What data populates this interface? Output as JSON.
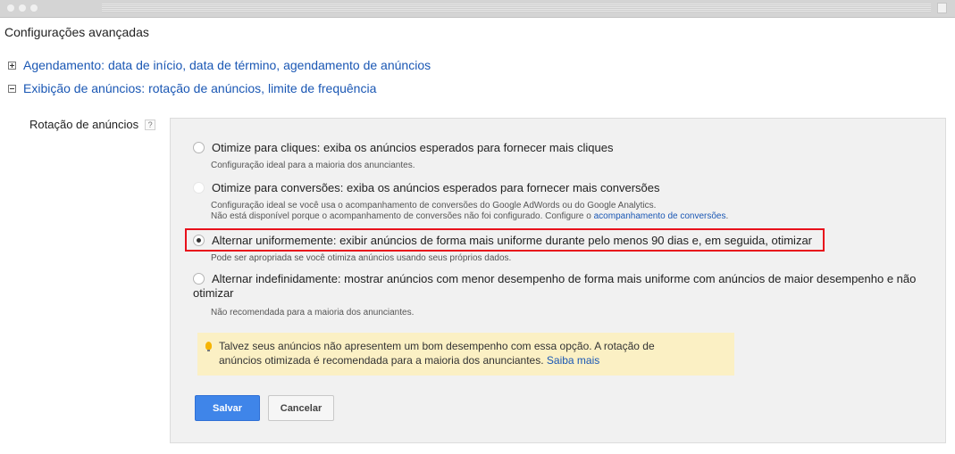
{
  "page": {
    "title": "Configurações avançadas"
  },
  "sections": [
    {
      "label": "Agendamento: data de início, data de término, agendamento de anúncios",
      "expanded": false
    },
    {
      "label": "Exibição de anúncios: rotação de anúncios, limite de frequência",
      "expanded": true
    }
  ],
  "field": {
    "label": "Rotação de anúncios",
    "help": "?"
  },
  "options": [
    {
      "label": "Otimize para cliques: exiba os anúncios esperados para fornecer mais cliques",
      "description": "Configuração ideal para a maioria dos anunciantes.",
      "state": "unchecked"
    },
    {
      "label": "Otimize para conversões: exiba os anúncios esperados para fornecer mais conversões",
      "description_line1": "Configuração ideal se você usa o acompanhamento de conversões do Google AdWords ou do Google Analytics.",
      "description_line2_prefix": "Não está disponível porque o acompanhamento de conversões não foi configurado. Configure o ",
      "description_link": "acompanhamento de conversões",
      "description_line2_suffix": ".",
      "state": "disabled"
    },
    {
      "label": "Alternar uniformemente: exibir anúncios de forma mais uniforme durante pelo menos 90 dias e, em seguida, otimizar",
      "description": "Pode ser apropriada se você otimiza anúncios usando seus próprios dados.",
      "state": "checked"
    },
    {
      "label_line1": "Alternar indefinidamente: mostrar anúncios com menor desempenho de forma mais uniforme com anúncios de maior desempenho e não",
      "label_line2": "otimizar",
      "description": "Não recomendada para a maioria dos anunciantes.",
      "state": "unchecked"
    }
  ],
  "tip": {
    "icon": "lightbulb-icon",
    "text_line1": "Talvez seus anúncios não apresentem um bom desempenho com essa opção. A rotação de",
    "text_line2": "anúncios otimizada é recomendada para a maioria dos anunciantes.",
    "link": "Saiba mais"
  },
  "buttons": {
    "save": "Salvar",
    "cancel": "Cancelar"
  },
  "colors": {
    "link": "#1a57b4",
    "primary_button": "#3f85e9",
    "highlight_border": "#e8101b",
    "tip_background": "#fbf0c4"
  }
}
